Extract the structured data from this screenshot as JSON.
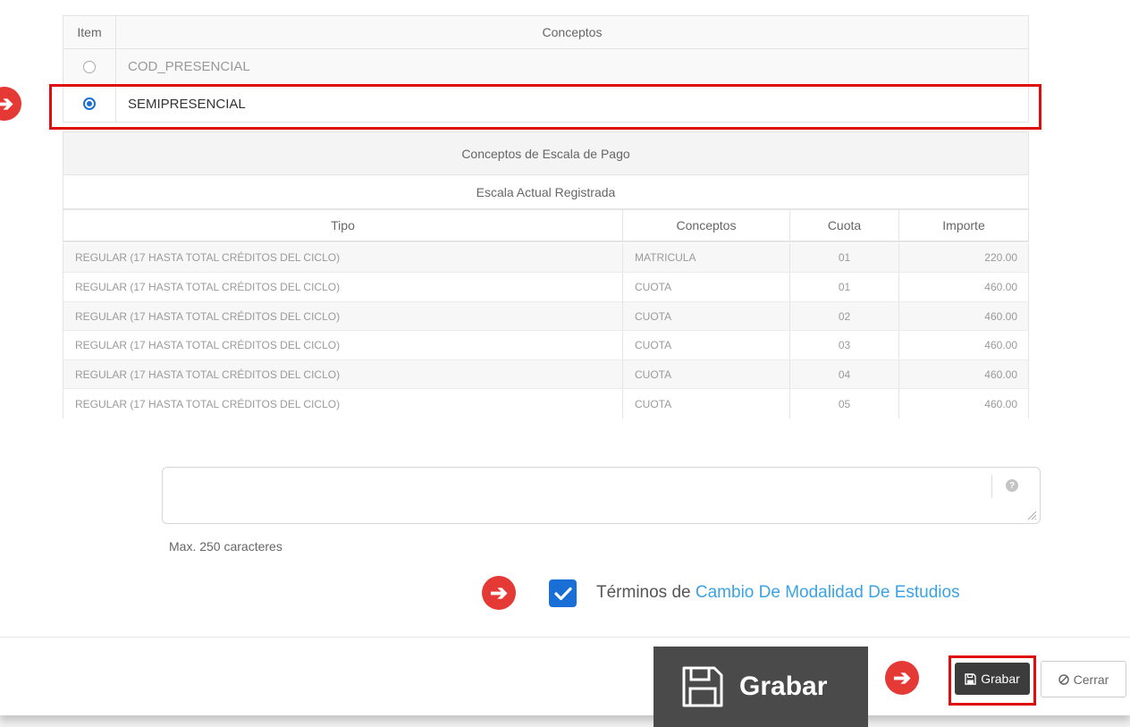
{
  "concepts_table": {
    "header_item": "Item",
    "header_conceptos": "Conceptos",
    "rows": [
      {
        "label": "COD_PRESENCIAL",
        "selected": false
      },
      {
        "label": "SEMIPRESENCIAL",
        "selected": true
      }
    ]
  },
  "scale_section": {
    "title": "Conceptos de Escala de Pago",
    "subtitle": "Escala Actual Registrada",
    "columns": [
      "Tipo",
      "Conceptos",
      "Cuota",
      "Importe"
    ],
    "rows": [
      [
        "REGULAR (17 HASTA TOTAL CRÉDITOS DEL CICLO)",
        "MATRICULA",
        "01",
        "220.00"
      ],
      [
        "REGULAR (17 HASTA TOTAL CRÉDITOS DEL CICLO)",
        "CUOTA",
        "01",
        "460.00"
      ],
      [
        "REGULAR (17 HASTA TOTAL CRÉDITOS DEL CICLO)",
        "CUOTA",
        "02",
        "460.00"
      ],
      [
        "REGULAR (17 HASTA TOTAL CRÉDITOS DEL CICLO)",
        "CUOTA",
        "03",
        "460.00"
      ],
      [
        "REGULAR (17 HASTA TOTAL CRÉDITOS DEL CICLO)",
        "CUOTA",
        "04",
        "460.00"
      ],
      [
        "REGULAR (17 HASTA TOTAL CRÉDITOS DEL CICLO)",
        "CUOTA",
        "05",
        "460.00"
      ]
    ]
  },
  "comment": {
    "value": "",
    "help_icon": "help-circle-icon",
    "max_hint": "Max. 250 caracteres"
  },
  "terms": {
    "checked": true,
    "prefix": "Términos de",
    "link": "Cambio De Modalidad De Estudios"
  },
  "footer": {
    "save_label": "Grabar",
    "close_label": "Cerrar",
    "save_icon": "floppy-disk-icon",
    "close_icon": "ban-icon"
  },
  "callout": {
    "label": "Grabar",
    "icon": "floppy-disk-icon"
  },
  "colors": {
    "highlight": "#e00d0d",
    "arrow": "#e53935",
    "link": "#3aa3e3",
    "checkbox": "#1a6fd6",
    "save_button": "#3c3c3c",
    "callout_bg": "#4a4a4a"
  }
}
